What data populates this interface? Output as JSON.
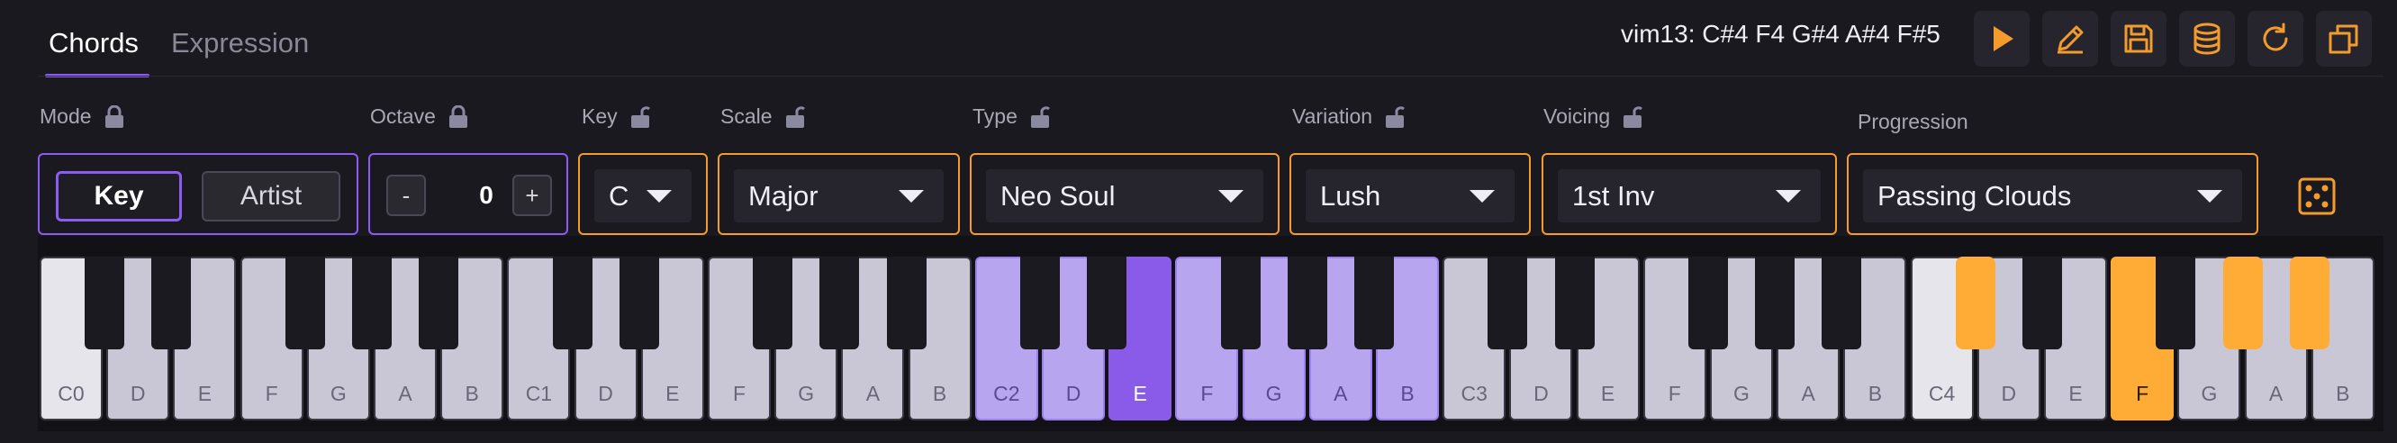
{
  "tabs": [
    {
      "label": "Chords",
      "active": true
    },
    {
      "label": "Expression",
      "active": false
    }
  ],
  "chord_readout": "vim13: C#4 F4 G#4 A#4 F#5",
  "toolbar": {
    "icons": [
      "play-icon",
      "pencil-icon",
      "save-icon",
      "database-icon",
      "refresh-icon",
      "copy-icon"
    ],
    "accent": "#f39c2c"
  },
  "controls": {
    "mode": {
      "label": "Mode",
      "locked": true,
      "options": [
        "Key",
        "Artist"
      ],
      "selected": "Key"
    },
    "octave": {
      "label": "Octave",
      "locked": true,
      "minus": "-",
      "value": "0",
      "plus": "+"
    },
    "key": {
      "label": "Key",
      "locked": false,
      "value": "C"
    },
    "scale": {
      "label": "Scale",
      "locked": false,
      "value": "Major"
    },
    "type": {
      "label": "Type",
      "locked": false,
      "value": "Neo Soul"
    },
    "variation": {
      "label": "Variation",
      "locked": false,
      "value": "Lush"
    },
    "voicing": {
      "label": "Voicing",
      "locked": false,
      "value": "1st Inv"
    },
    "progression": {
      "label": "Progression",
      "value": "Passing Clouds"
    }
  },
  "keyboard": {
    "white_labels": [
      "C0",
      "D",
      "E",
      "F",
      "G",
      "A",
      "B",
      "C1",
      "D",
      "E",
      "F",
      "G",
      "A",
      "B",
      "C2",
      "D",
      "E",
      "F",
      "G",
      "A",
      "B",
      "C3",
      "D",
      "E",
      "F",
      "G",
      "A",
      "B",
      "C4",
      "D",
      "E",
      "F",
      "G",
      "A",
      "B"
    ],
    "highlight_scale_octave": 2,
    "highlight_root": "E2",
    "played_notes": [
      "C#4",
      "F4",
      "G#4",
      "A#4",
      "F#5"
    ]
  },
  "colors": {
    "purple_accent": "#8a5cf0",
    "orange_accent": "#f39c2c",
    "played": "#ffac36",
    "scale_highlight": "#b7a5f0"
  }
}
